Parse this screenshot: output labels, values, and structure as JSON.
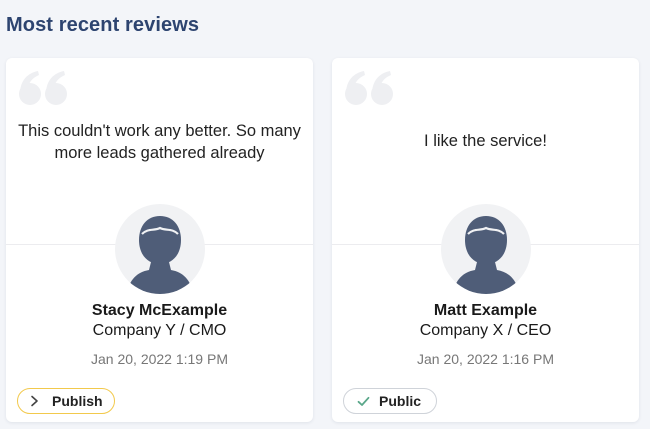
{
  "heading": "Most recent reviews",
  "reviews": [
    {
      "text": "This couldn't work any better. So many more leads gathered already",
      "name": "Stacy McExample",
      "company": "Company Y / CMO",
      "date": "Jan 20, 2022 1:19 PM",
      "action": {
        "label": "Publish",
        "icon": "chevron-right-icon",
        "border_color": "#f2c94c"
      }
    },
    {
      "text": "I like the service!",
      "name": "Matt Example",
      "company": "Company X / CEO",
      "date": "Jan 20, 2022 1:16 PM",
      "action": {
        "label": "Public",
        "icon": "check-icon",
        "icon_color": "#5aa78a"
      }
    }
  ],
  "colors": {
    "heading": "#2d4470",
    "avatar_silhouette": "#4f5d78",
    "quote_icon": "#eeeff2"
  }
}
